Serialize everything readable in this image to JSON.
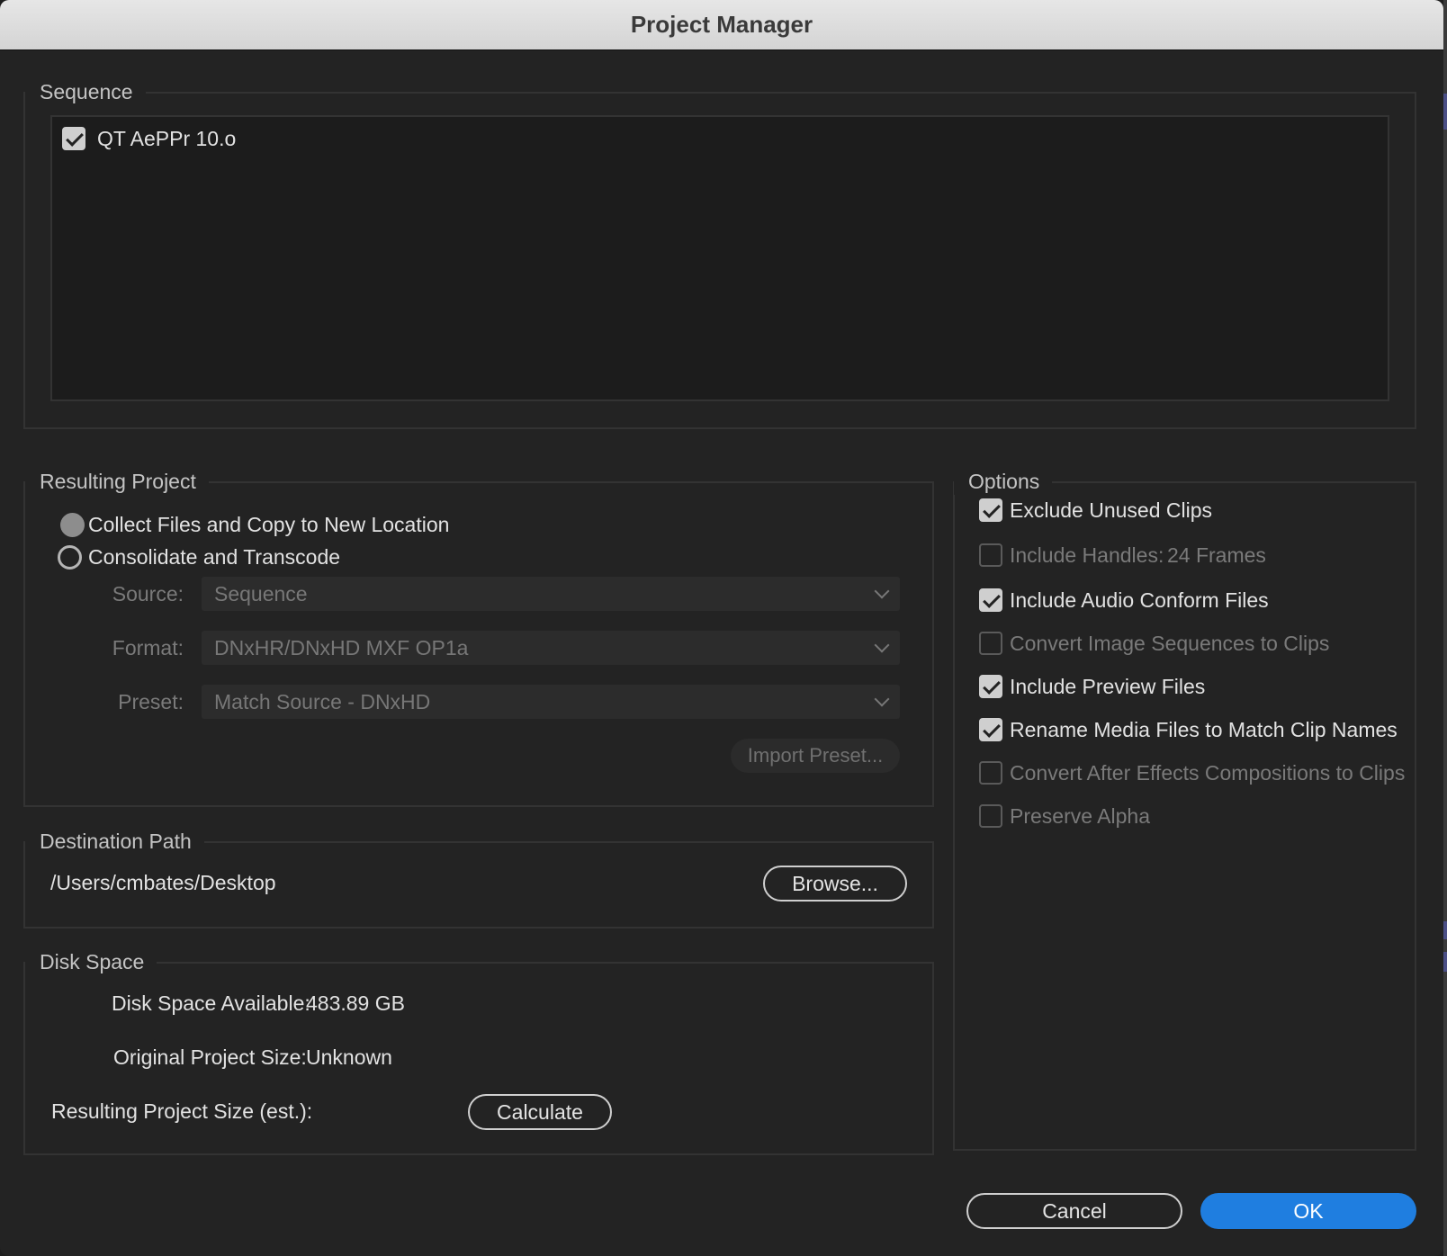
{
  "window": {
    "title": "Project Manager"
  },
  "sequence": {
    "legend": "Sequence",
    "items": [
      {
        "label": "QT AePPr 10.o",
        "checked": true
      }
    ]
  },
  "resulting_project": {
    "legend": "Resulting Project",
    "options": [
      {
        "label": "Collect Files and Copy to New Location",
        "selected": true
      },
      {
        "label": "Consolidate and Transcode",
        "selected": false
      }
    ],
    "source": {
      "label": "Source:",
      "value": "Sequence"
    },
    "format": {
      "label": "Format:",
      "value": "DNxHR/DNxHD MXF OP1a"
    },
    "preset": {
      "label": "Preset:",
      "value": "Match Source - DNxHD"
    },
    "import_preset_label": "Import Preset..."
  },
  "destination": {
    "legend": "Destination Path",
    "path": "/Users/cmbates/Desktop",
    "browse_label": "Browse..."
  },
  "disk_space": {
    "legend": "Disk Space",
    "available_label": "Disk Space Available:",
    "available_value": "483.89 GB",
    "original_label": "Original Project Size:",
    "original_value": "Unknown",
    "resulting_label": "Resulting Project Size (est.):",
    "calculate_label": "Calculate"
  },
  "options": {
    "legend": "Options",
    "items": [
      {
        "label": "Exclude Unused Clips",
        "checked": true,
        "enabled": true
      },
      {
        "label": "Include Handles:",
        "extra": "24 Frames",
        "checked": false,
        "enabled": false
      },
      {
        "label": "Include Audio Conform Files",
        "checked": true,
        "enabled": true
      },
      {
        "label": "Convert Image Sequences to Clips",
        "checked": false,
        "enabled": false
      },
      {
        "label": "Include Preview Files",
        "checked": true,
        "enabled": true
      },
      {
        "label": "Rename Media Files to Match Clip Names",
        "checked": true,
        "enabled": true
      },
      {
        "label": "Convert After Effects Compositions to Clips",
        "checked": false,
        "enabled": false
      },
      {
        "label": "Preserve Alpha",
        "checked": false,
        "enabled": false
      }
    ]
  },
  "footer": {
    "cancel_label": "Cancel",
    "ok_label": "OK"
  },
  "colors": {
    "accent": "#1f7ee0",
    "background": "#232323",
    "titlebar": "#dcdcdc"
  }
}
